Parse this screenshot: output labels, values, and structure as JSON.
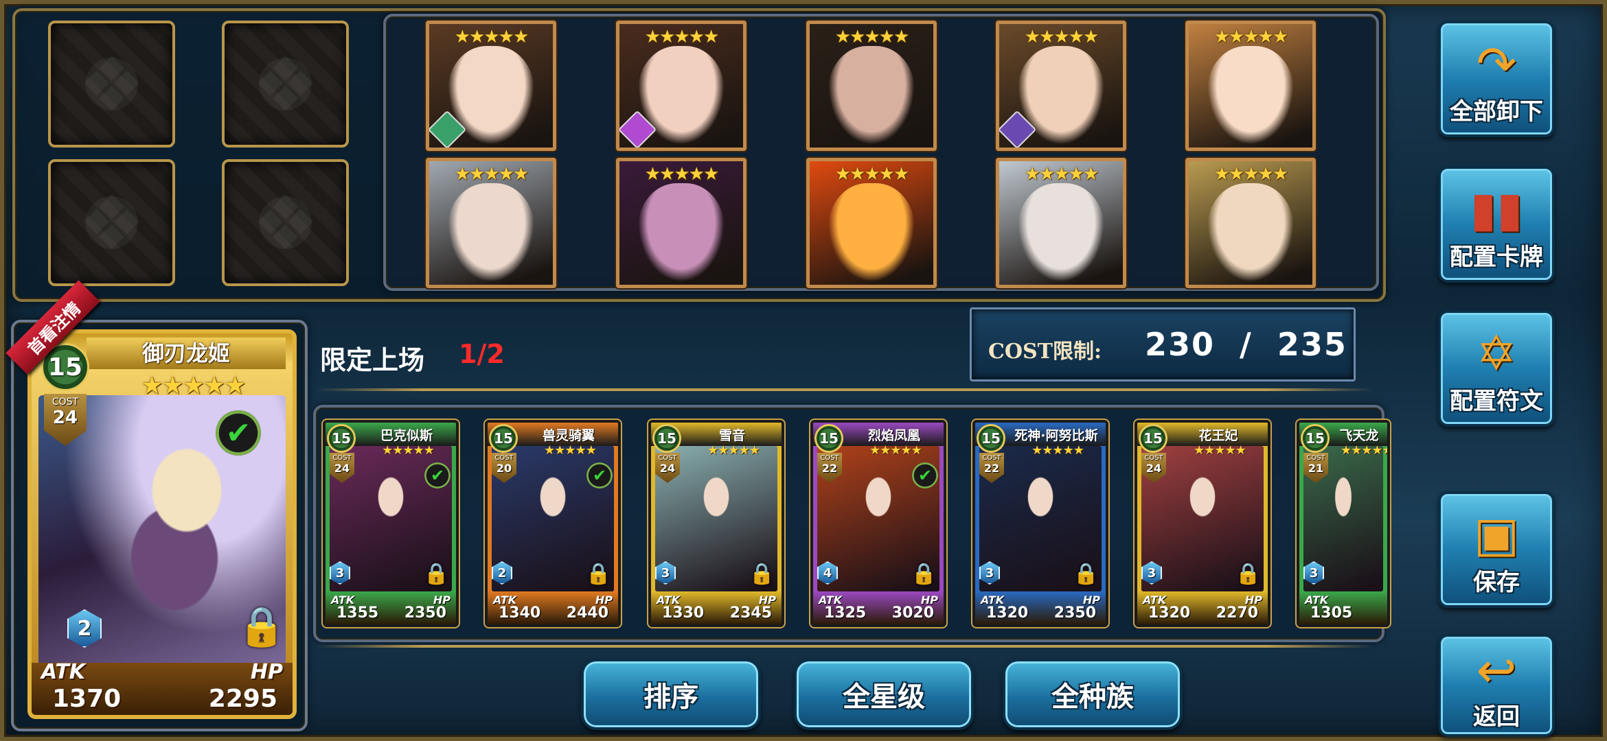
{
  "side_buttons": {
    "unload_all": "全部卸下",
    "configure_cards": "配置卡牌",
    "configure_runes": "配置符文",
    "save": "保存",
    "back": "返回"
  },
  "bottom_buttons": {
    "sort": "排序",
    "all_stars": "全星级",
    "all_races": "全种族"
  },
  "cost_limit": {
    "label": "COST限制:",
    "value": "230  /  235"
  },
  "limit_onstage": {
    "label": "限定上场",
    "count": "1/2"
  },
  "feature_card": {
    "ribbon": "首看注情",
    "level": "15",
    "cost_label": "COST",
    "cost": "24",
    "name": "御刃龙姬",
    "stars": "★★★★★",
    "gem": "2",
    "atk_label": "ATK",
    "hp_label": "HP",
    "atk": "1370",
    "hp": "2295",
    "check": "✔",
    "lock": "🔒"
  },
  "portraits": {
    "stars": "★★★★★",
    "items": [
      {
        "name": "portrait-1"
      },
      {
        "name": "portrait-2"
      },
      {
        "name": "portrait-3"
      },
      {
        "name": "portrait-4"
      },
      {
        "name": "portrait-5"
      },
      {
        "name": "portrait-6"
      },
      {
        "name": "portrait-7"
      },
      {
        "name": "portrait-8"
      },
      {
        "name": "portrait-9"
      },
      {
        "name": "portrait-10"
      }
    ]
  },
  "cards": [
    {
      "level": "15",
      "cost": "24",
      "name": "巴克似斯",
      "stars": "★★★★★",
      "gem": "3",
      "atk": "1355",
      "hp": "2350",
      "checked": true,
      "color": "#3aa84a"
    },
    {
      "level": "15",
      "cost": "20",
      "name": "兽灵骑翼",
      "stars": "★★★★★",
      "gem": "2",
      "atk": "1340",
      "hp": "2440",
      "checked": true,
      "color": "#e07a22"
    },
    {
      "level": "15",
      "cost": "24",
      "name": "雪音",
      "stars": "★★★★★",
      "gem": "3",
      "atk": "1330",
      "hp": "2345",
      "checked": false,
      "color": "#e0b82a"
    },
    {
      "level": "15",
      "cost": "22",
      "name": "烈焰凤凰",
      "stars": "★★★★★",
      "gem": "4",
      "atk": "1325",
      "hp": "3020",
      "checked": true,
      "color": "#9a4ac0"
    },
    {
      "level": "15",
      "cost": "22",
      "name": "死神·阿努比斯",
      "stars": "★★★★★",
      "gem": "3",
      "atk": "1320",
      "hp": "2350",
      "checked": false,
      "color": "#2a6ac0"
    },
    {
      "level": "15",
      "cost": "24",
      "name": "花王妃",
      "stars": "★★★★★",
      "gem": "3",
      "atk": "1320",
      "hp": "2270",
      "checked": false,
      "color": "#e0b82a"
    },
    {
      "level": "15",
      "cost": "21",
      "name": "飞天龙",
      "stars": "★★★★★",
      "gem": "3",
      "atk": "1305",
      "hp": "",
      "checked": false,
      "color": "#3aa84a"
    }
  ],
  "labels": {
    "atk": "ATK",
    "hp": "HP",
    "cost": "COST"
  }
}
